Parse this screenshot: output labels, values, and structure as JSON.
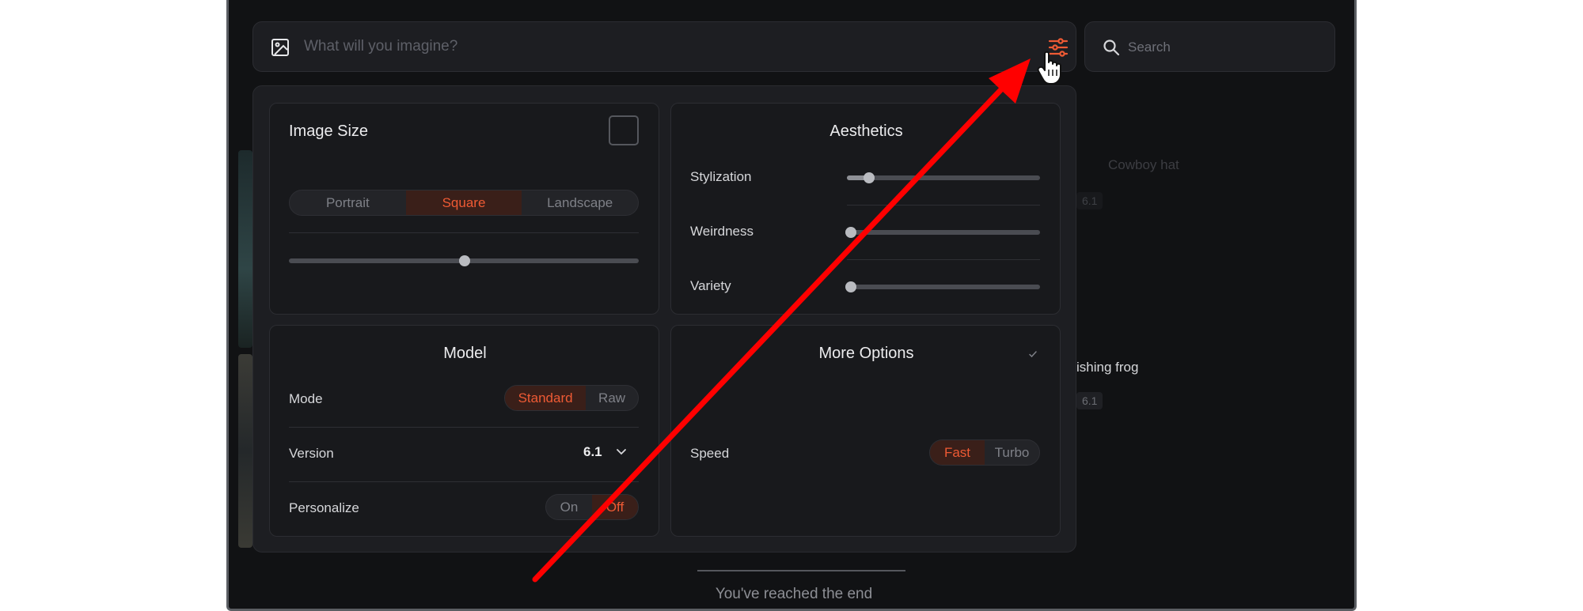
{
  "prompt": {
    "placeholder": "What will you imagine?"
  },
  "search": {
    "placeholder": "Search"
  },
  "background_feed": {
    "item1_title": "Cowboy hat",
    "item1_version": "6.1",
    "item2_title": "ishing frog",
    "item2_version": "6.1"
  },
  "image_size": {
    "title": "Image Size",
    "options": [
      "Portrait",
      "Square",
      "Landscape"
    ],
    "selected": "Square",
    "aspect_slider_level": 0.5
  },
  "aesthetics": {
    "title": "Aesthetics",
    "sliders": [
      {
        "label": "Stylization",
        "level": 0.11
      },
      {
        "label": "Weirdness",
        "level": 0.0
      },
      {
        "label": "Variety",
        "level": 0.0
      }
    ]
  },
  "model": {
    "title": "Model",
    "mode_label": "Mode",
    "mode_options": [
      "Standard",
      "Raw"
    ],
    "mode_selected": "Standard",
    "version_label": "Version",
    "version_value": "6.1",
    "personalize_label": "Personalize",
    "personalize_options": [
      "On",
      "Off"
    ],
    "personalize_selected": "Off"
  },
  "more_options": {
    "title": "More Options",
    "speed_label": "Speed",
    "speed_options": [
      "Fast",
      "Turbo"
    ],
    "speed_selected": "Fast"
  },
  "footer": {
    "end_text": "You've reached the end"
  },
  "colors": {
    "accent": "#ee5a34",
    "background": "#111214",
    "panel": "#1d1e22",
    "annotation_arrow": "#ff0000"
  },
  "icons": [
    "image-icon",
    "settings-sliders-icon",
    "search-icon",
    "pointer-hand-icon",
    "chevron-down-icon",
    "check-icon"
  ]
}
